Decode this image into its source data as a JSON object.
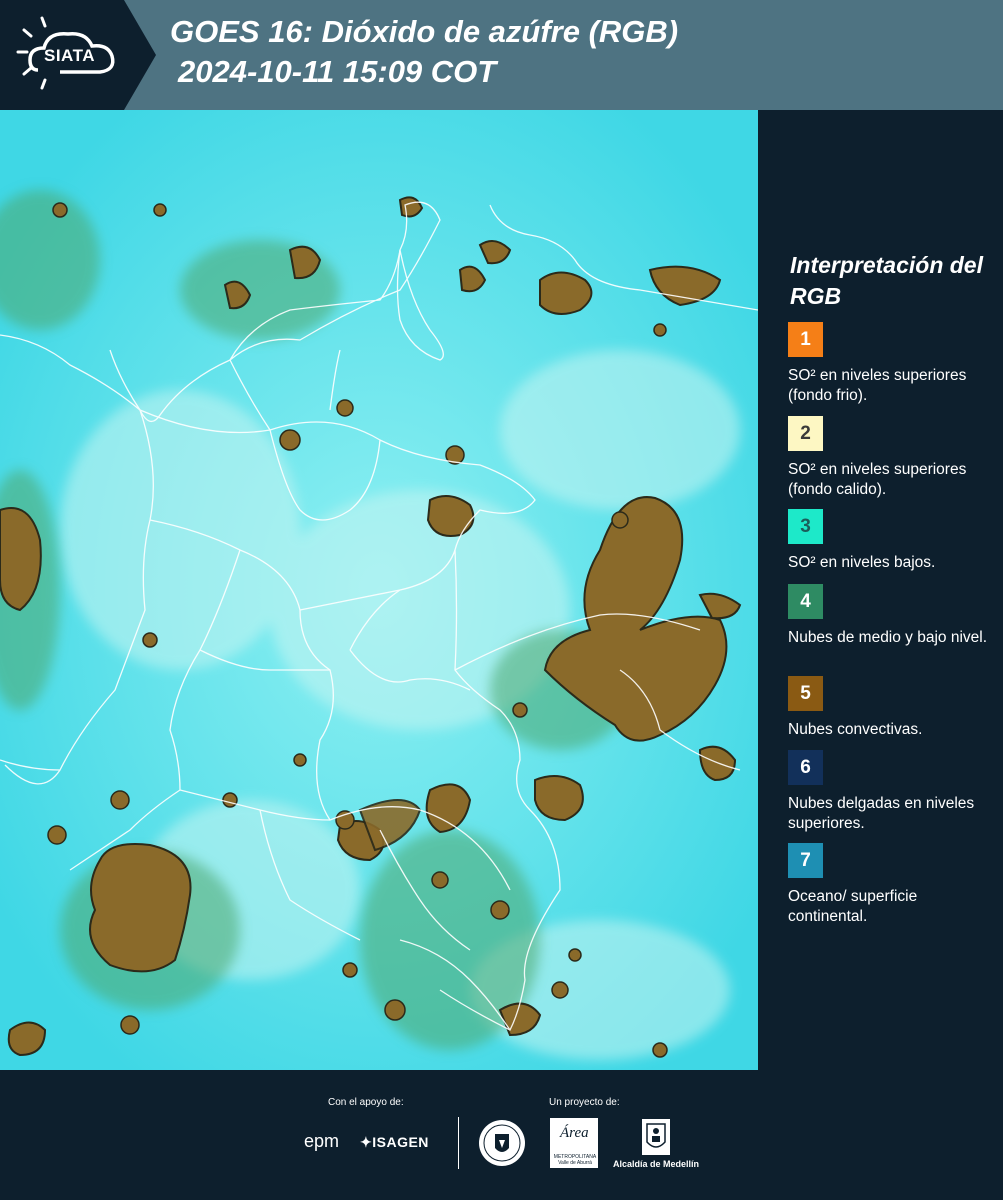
{
  "header": {
    "logo_text": "SIATA",
    "title": "GOES 16: Dióxido de azúfre (RGB)",
    "datetime": "2024-10-11 15:09 COT",
    "background": "#4e7382",
    "logo_background": "#0d1f2d"
  },
  "map": {
    "type": "satellite-rgb-composite",
    "background_color": "#3fdde8",
    "convective_cloud_color": "#8a6a2a",
    "boundary_color": "#ffffff"
  },
  "legend": {
    "title": "Interpretación del RGB",
    "items": [
      {
        "number": "1",
        "color": "#f57f17",
        "text_color": "#ffffff",
        "label": "SO² en niveles superiores (fondo frio)."
      },
      {
        "number": "2",
        "color": "#fdf7c3",
        "text_color": "#3a3a3a",
        "label": "SO² en niveles superiores (fondo calido)."
      },
      {
        "number": "3",
        "color": "#1de9c9",
        "text_color": "#1b5e5a",
        "label": "SO² en niveles bajos."
      },
      {
        "number": "4",
        "color": "#2e8b63",
        "text_color": "#ffffff",
        "label": "Nubes de medio y bajo nivel."
      },
      {
        "number": "5",
        "color": "#8a5a13",
        "text_color": "#ffffff",
        "label": "Nubes convectivas."
      },
      {
        "number": "6",
        "color": "#12305a",
        "text_color": "#ffffff",
        "label": "Nubes delgadas en niveles superiores."
      },
      {
        "number": "7",
        "color": "#1e8fb3",
        "text_color": "#ffffff",
        "label": "Oceano/ superficie continental."
      }
    ]
  },
  "footer": {
    "support_label": "Con el apoyo de:",
    "project_label": "Un proyecto de:",
    "sponsor_1": "epm",
    "sponsor_2": "ISAGEN",
    "area_logo_word": "Área",
    "area_logo_sub": "METROPOLITANA Valle de Aburrá",
    "alcaldia_label": "Alcaldía de Medellín"
  }
}
